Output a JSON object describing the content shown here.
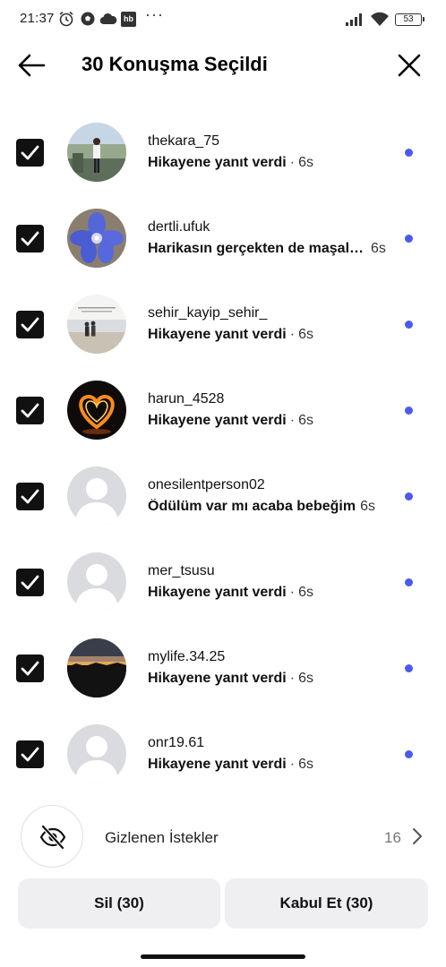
{
  "status_bar": {
    "time": "21:37",
    "battery": "53",
    "more": "···",
    "icons": [
      "alarm-icon",
      "soccer-ball-icon",
      "cloud-icon",
      "hb-app-icon",
      "signal-icon",
      "wifi-icon",
      "battery-icon"
    ],
    "hb_label": "hb"
  },
  "header": {
    "title": "30 Konuşma Seçildi"
  },
  "conversations": [
    {
      "username": "thekara_75",
      "preview": "Hikayene yanıt verdi",
      "separator": "·",
      "time": "6s",
      "truncated": false,
      "checked": true,
      "unread": true
    },
    {
      "username": "dertli.ufuk",
      "preview": "Harikasın gerçekten de maşallah",
      "separator": "",
      "time": "6s",
      "truncated": true,
      "checked": true,
      "unread": true
    },
    {
      "username": "sehir_kayip_sehir_",
      "preview": "Hikayene yanıt verdi",
      "separator": "·",
      "time": "6s",
      "truncated": false,
      "checked": true,
      "unread": true
    },
    {
      "username": "harun_4528",
      "preview": "Hikayene yanıt verdi",
      "separator": "·",
      "time": "6s",
      "truncated": false,
      "checked": true,
      "unread": true
    },
    {
      "username": "onesilentperson02",
      "preview": "Ödülüm var mı acaba bebeğim",
      "separator": "",
      "time": "6s",
      "truncated": true,
      "checked": true,
      "unread": true
    },
    {
      "username": "mer_tsusu",
      "preview": "Hikayene yanıt verdi",
      "separator": "·",
      "time": "6s",
      "truncated": false,
      "checked": true,
      "unread": true
    },
    {
      "username": "mylife.34.25",
      "preview": "Hikayene yanıt verdi",
      "separator": "·",
      "time": "6s",
      "truncated": false,
      "checked": true,
      "unread": true
    },
    {
      "username": "onr19.61",
      "preview": "Hikayene yanıt verdi",
      "separator": "·",
      "time": "6s",
      "truncated": false,
      "checked": true,
      "unread": true
    }
  ],
  "hidden_requests": {
    "label": "Gizlenen İstekler",
    "count": "16"
  },
  "actions": {
    "delete_label": "Sil (30)",
    "accept_label": "Kabul Et (30)"
  },
  "colors": {
    "unread_dot": "#4a5af0",
    "button_bg": "#efeff2",
    "checkbox": "#111111"
  }
}
